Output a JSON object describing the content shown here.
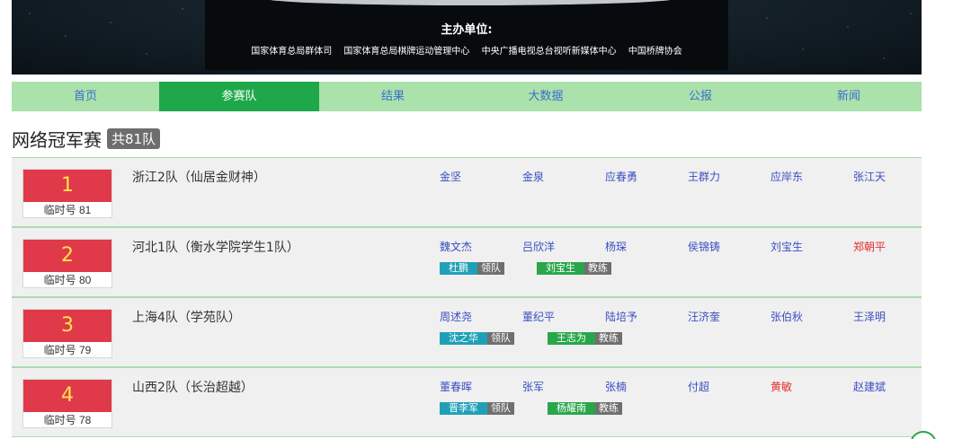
{
  "banner": {
    "sponsor_title": "主办单位:",
    "sponsors": [
      "国家体育总局群体司",
      "国家体育总局棋牌运动管理中心",
      "中央广播电视总台视听新媒体中心",
      "中国桥牌协会"
    ]
  },
  "nav": {
    "tabs": [
      {
        "label": "首页",
        "active": false
      },
      {
        "label": "参赛队",
        "active": true
      },
      {
        "label": "结果",
        "active": false
      },
      {
        "label": "大数据",
        "active": false
      },
      {
        "label": "公报",
        "active": false
      },
      {
        "label": "新闻",
        "active": false
      }
    ]
  },
  "heading": {
    "title": "网络冠军赛",
    "count": "共81队"
  },
  "teams": [
    {
      "rank": "1",
      "temp": "临时号 81",
      "name": "浙江2队（仙居金财神）",
      "players": [
        "金坚",
        "金泉",
        "应春勇",
        "王群力",
        "应岸东",
        "张江天"
      ],
      "staff": []
    },
    {
      "rank": "2",
      "temp": "临时号 80",
      "name": "河北1队（衡水学院学生1队）",
      "players": [
        "魏文杰",
        "吕欣洋",
        "杨琛",
        "侯锦铸",
        "刘宝生",
        "郑朝平"
      ],
      "staff": [
        {
          "name": "杜鹏",
          "role": "领队"
        },
        {
          "name": "刘宝生",
          "role": "教练"
        }
      ]
    },
    {
      "rank": "3",
      "temp": "临时号 79",
      "name": "上海4队（学苑队）",
      "players": [
        "周述尧",
        "董纪平",
        "陆培予",
        "汪济奎",
        "张伯秋",
        "王泽明"
      ],
      "staff": [
        {
          "name": "沈之华",
          "role": "领队"
        },
        {
          "name": "王志为",
          "role": "教练"
        }
      ]
    },
    {
      "rank": "4",
      "temp": "临时号 78",
      "name": "山西2队（长治超越）",
      "players": [
        "董春晖",
        "张军",
        "张楠",
        "付超",
        "黄敏",
        "赵建斌"
      ],
      "staff": [
        {
          "name": "晋李军",
          "role": "领队"
        },
        {
          "name": "杨耀南",
          "role": "教练"
        }
      ]
    }
  ],
  "colors": {
    "nav_bg": "#abe1aa",
    "nav_active": "#1fa84a",
    "rank_bg": "#e0394a",
    "rank_text": "#ffe34a",
    "player_link": "#3a4ec2",
    "player_highlight": "#e53030"
  }
}
